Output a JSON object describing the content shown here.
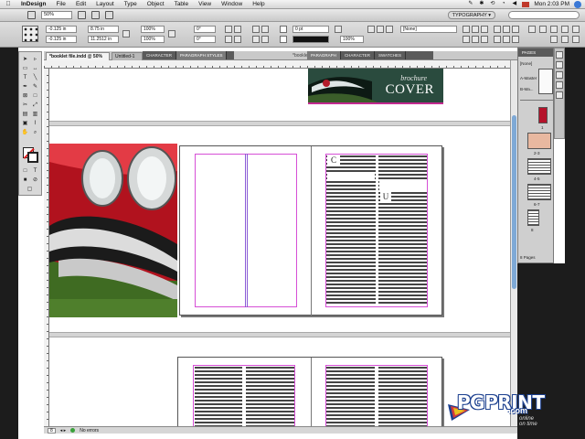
{
  "menubar": {
    "apple": "",
    "app_name": "InDesign",
    "items": [
      "File",
      "Edit",
      "Layout",
      "Type",
      "Object",
      "Table",
      "View",
      "Window",
      "Help"
    ],
    "clock": "Mon 2:03 PM"
  },
  "appbar": {
    "zoom": "50%",
    "workspace": "TYPOGRAPHY ▾"
  },
  "control": {
    "x_value": "-0.125 in",
    "y_value": "-0.125 in",
    "w_value": "8.75 in",
    "h_value": "11.2512 in",
    "scale_x": "100%",
    "scale_y": "100%",
    "rotate": "0°",
    "shear": "0°",
    "stroke_weight": "0 pt",
    "opacity": "100%",
    "style": "[None]"
  },
  "doc_tabs": {
    "tab1": "*booklet file.indd @ 50%",
    "tab2": "Untitled-1",
    "title": "*booklet file.indd @ 5..."
  },
  "float_panel_1": {
    "tabs": [
      "CHARACTER",
      "PARAGRAPH STYLES"
    ]
  },
  "float_panel_2": {
    "tabs": [
      "PARAGRAPH",
      "CHARACTER",
      "SWATCHES"
    ]
  },
  "cover": {
    "line1": "brochure",
    "line2": "COVER"
  },
  "spread": {
    "dropcap1": "C",
    "dropcap2": "U"
  },
  "pages_panel": {
    "header": "PAGES",
    "none_label": "[None]",
    "master_label": "A-Master",
    "b_master_label": "B-Ma...",
    "page_numbers": [
      "1",
      "2-3",
      "4-5",
      "6-7",
      "8"
    ],
    "footer": "8 Pages"
  },
  "statusbar": {
    "page": "8",
    "preflight": "No errors"
  },
  "watermark": {
    "brand": "PGPRINT",
    "domain": ".com",
    "tagline_1": "online",
    "tagline_2": "on time"
  }
}
